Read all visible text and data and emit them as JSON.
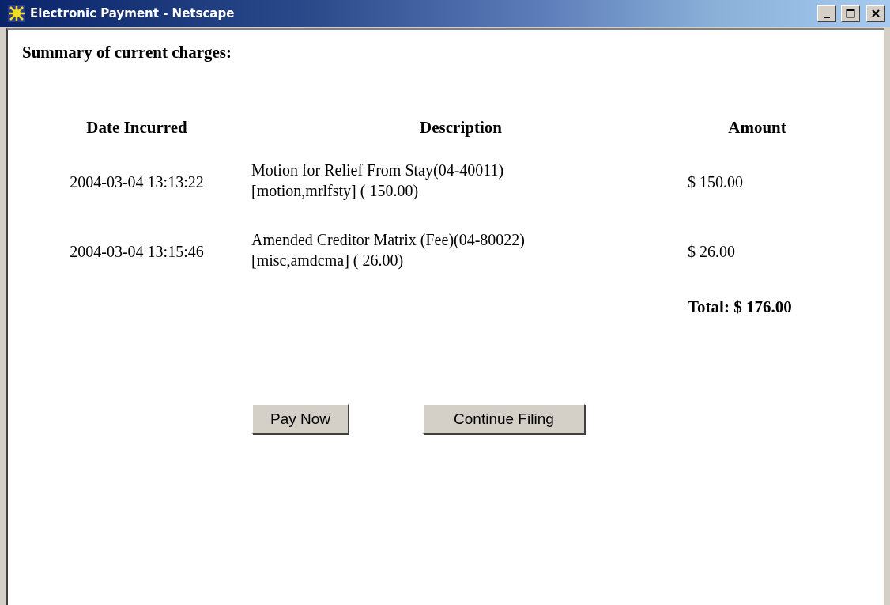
{
  "window": {
    "title": "Electronic Payment - Netscape"
  },
  "heading": "Summary of current charges:",
  "table": {
    "columns": [
      "Date Incurred",
      "Description",
      "Amount"
    ],
    "rows": [
      {
        "date": "2004-03-04 13:13:22",
        "description": [
          "Motion for Relief From Stay(04-40011)",
          "[motion,mrlfsty] ( 150.00)"
        ],
        "amount": "$ 150.00"
      },
      {
        "date": "2004-03-04 13:15:46",
        "description": [
          "Amended Creditor Matrix (Fee)(04-80022)",
          "[misc,amdcma] ( 26.00)"
        ],
        "amount": "$ 26.00"
      }
    ],
    "total": "Total: $ 176.00"
  },
  "buttons": [
    "Pay Now",
    "Continue Filing"
  ]
}
